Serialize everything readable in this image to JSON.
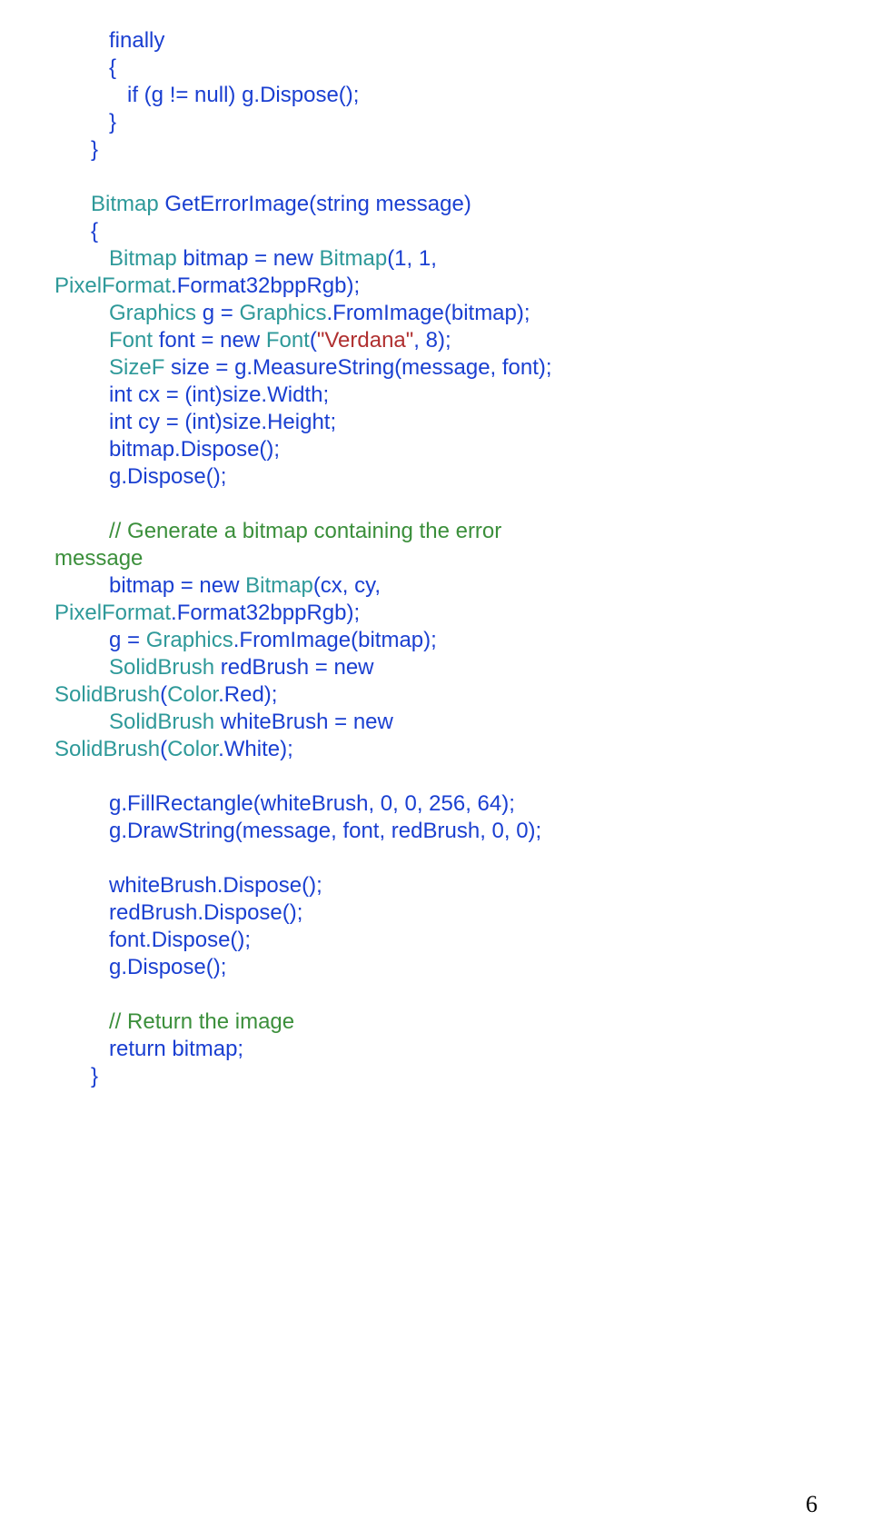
{
  "page_number": "6",
  "code": {
    "l01": "         finally",
    "l02": "         {",
    "l03a": "            if",
    "l03b": " (g != ",
    "l03c": "null",
    "l03d": ") g.Dispose();",
    "l04": "         }",
    "l05": "      }",
    "l06a": "      ",
    "l06b": "Bitmap",
    "l06c": " GetErrorImage(",
    "l06d": "string",
    "l06e": " message)",
    "l07": "      {",
    "l08a": "         ",
    "l08b": "Bitmap",
    "l08c": " bitmap = ",
    "l08d": "new",
    "l08e": " ",
    "l08f": "Bitmap",
    "l08g": "(1, 1,",
    "l09a": "PixelFormat",
    "l09b": ".Format32bppRgb);",
    "l10a": "         ",
    "l10b": "Graphics",
    "l10c": " g = ",
    "l10d": "Graphics",
    "l10e": ".FromImage(bitmap);",
    "l11a": "         ",
    "l11b": "Font",
    "l11c": " font = ",
    "l11d": "new",
    "l11e": " ",
    "l11f": "Font",
    "l11g": "(",
    "l11h": "\"Verdana\"",
    "l11i": ", 8);",
    "l12a": "         ",
    "l12b": "SizeF",
    "l12c": " size = g.MeasureString(message, font);",
    "l13a": "         ",
    "l13b": "int",
    "l13c": " cx = (",
    "l13d": "int",
    "l13e": ")size.Width;",
    "l14a": "         ",
    "l14b": "int",
    "l14c": " cy = (",
    "l14d": "int",
    "l14e": ")size.Height;",
    "l15": "         bitmap.Dispose();",
    "l16": "         g.Dispose();",
    "l17a": "         ",
    "l17b": "// Generate a bitmap containing the error",
    "l18": "message",
    "l19a": "         bitmap = ",
    "l19b": "new",
    "l19c": " ",
    "l19d": "Bitmap",
    "l19e": "(cx, cy,",
    "l20a": "PixelFormat",
    "l20b": ".Format32bppRgb);",
    "l21a": "         g = ",
    "l21b": "Graphics",
    "l21c": ".FromImage(bitmap);",
    "l22a": "         ",
    "l22b": "SolidBrush",
    "l22c": " redBrush = ",
    "l22d": "new",
    "l23a": "SolidBrush",
    "l23b": "(",
    "l23c": "Color",
    "l23d": ".Red);",
    "l24a": "         ",
    "l24b": "SolidBrush",
    "l24c": " whiteBrush = ",
    "l24d": "new",
    "l25a": "SolidBrush",
    "l25b": "(",
    "l25c": "Color",
    "l25d": ".White);",
    "l26": "         g.FillRectangle(whiteBrush, 0, 0, 256, 64);",
    "l27": "         g.DrawString(message, font, redBrush, 0, 0);",
    "l28": "         whiteBrush.Dispose();",
    "l29": "         redBrush.Dispose();",
    "l30": "         font.Dispose();",
    "l31": "         g.Dispose();",
    "l32a": "         ",
    "l32b": "// Return the image",
    "l33a": "         ",
    "l33b": "return",
    "l33c": " bitmap;",
    "l34": "      }"
  }
}
